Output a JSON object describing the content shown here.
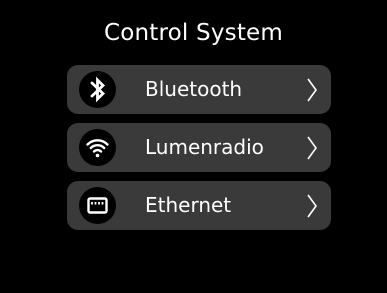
{
  "title": "Control System",
  "colors": {
    "background": "#000000",
    "item_background": "#3a3a3a",
    "text": "#ffffff",
    "icon_circle": "#000000"
  },
  "menu": {
    "items": [
      {
        "label": "Bluetooth",
        "icon": "bluetooth-icon"
      },
      {
        "label": "Lumenradio",
        "icon": "wifi-icon"
      },
      {
        "label": "Ethernet",
        "icon": "ethernet-icon"
      }
    ]
  }
}
